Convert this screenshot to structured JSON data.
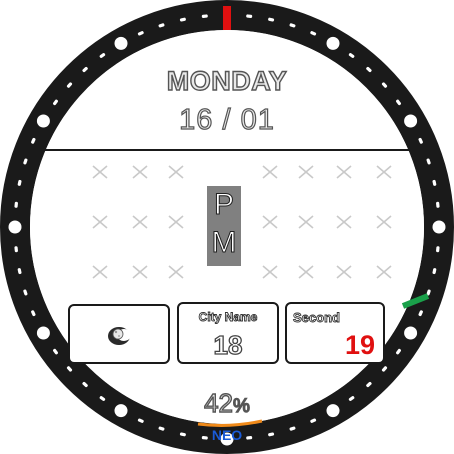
{
  "watchface": {
    "day": "MONDAY",
    "date": "16 / 01",
    "ampm_top": "P",
    "ampm_bottom": "M",
    "battery": {
      "value": "42",
      "unit": "%",
      "level_fraction": 0.42
    },
    "brand": "NEO",
    "widgets": {
      "weather": {
        "icon": "moon-icon"
      },
      "city": {
        "title": "City Name",
        "value": "18"
      },
      "second": {
        "title": "Second",
        "value": "19"
      }
    }
  },
  "colors": {
    "bezel": "#1a1a1a",
    "bezel_marker": "#ffffff",
    "twelve_marker": "#e01010",
    "second_hand_marker": "#1aa04a",
    "battery_indicator": "#f08a1a",
    "brand": "#1a5ad6",
    "second_value": "#e01010",
    "ampm_background": "#808080"
  }
}
